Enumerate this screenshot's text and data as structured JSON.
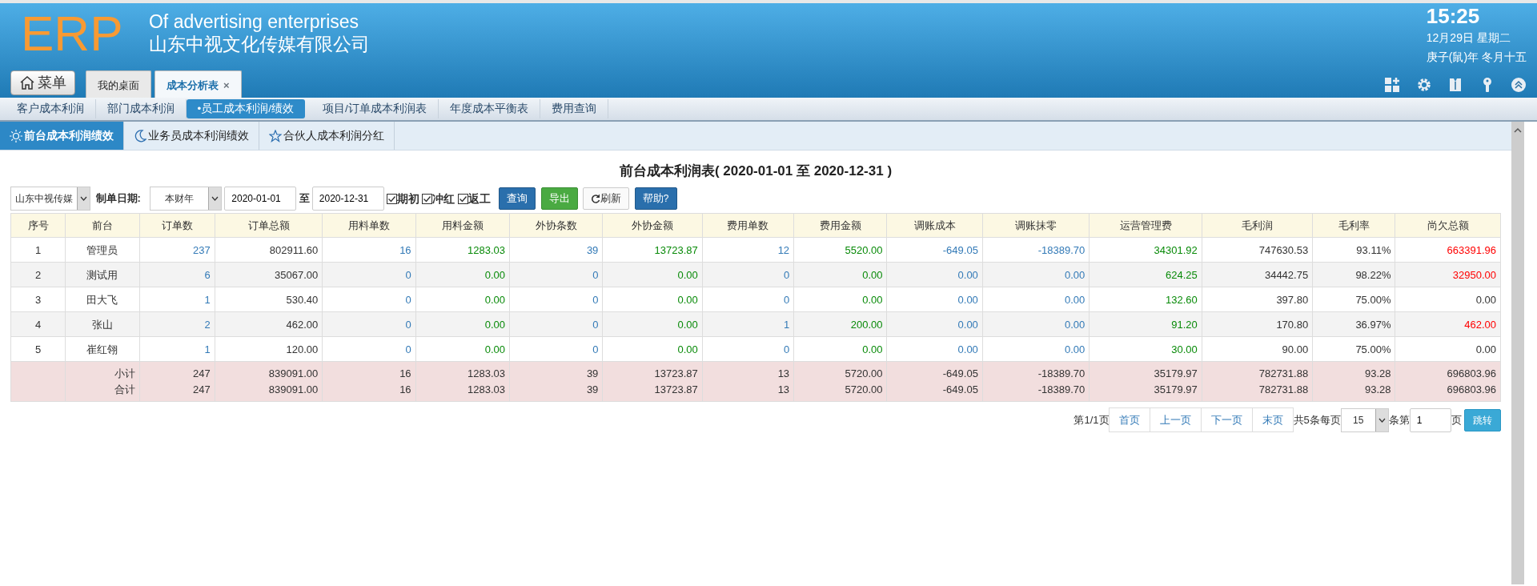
{
  "header": {
    "logo": "ERP",
    "subtitle": "Of advertising enterprises",
    "company": "山东中视文化传媒有限公司",
    "clock": {
      "time": "15:25",
      "date": "12月29日 星期二",
      "lunar": "庚子(鼠)年 冬月十五"
    },
    "menu_button": "菜单",
    "tabs": [
      {
        "label": "我的桌面",
        "selected": false,
        "closable": false
      },
      {
        "label": "成本分析表",
        "selected": true,
        "closable": true
      }
    ],
    "close_glyph": "×"
  },
  "subnav": [
    {
      "label": "客户成本利润",
      "selected": false
    },
    {
      "label": "部门成本利润",
      "selected": false
    },
    {
      "label": "•员工成本利润/绩效",
      "selected": true
    },
    {
      "label": "项目/订单成本利润表",
      "selected": false
    },
    {
      "label": "年度成本平衡表",
      "selected": false
    },
    {
      "label": "费用查询",
      "selected": false
    }
  ],
  "report_tabs": [
    {
      "label": "前台成本利润绩效",
      "selected": true
    },
    {
      "label": "业务员成本利润绩效",
      "selected": false
    },
    {
      "label": "合伙人成本利润分红",
      "selected": false
    }
  ],
  "report_title": "前台成本利润表( 2020-01-01 至 2020-12-31 )",
  "filters": {
    "company": "山东中视传媒",
    "date_label": "制单日期:",
    "period": "本财年",
    "date_from": "2020-01-01",
    "to_label": "至",
    "date_to": "2020-12-31",
    "checks": [
      {
        "label": "期初",
        "checked": true
      },
      {
        "label": "冲红",
        "checked": true
      },
      {
        "label": "返工",
        "checked": true
      }
    ],
    "buttons": [
      {
        "label": "查询",
        "kind": "primary"
      },
      {
        "label": "导出",
        "kind": "success"
      },
      {
        "label": "刷新",
        "kind": "refresh"
      },
      {
        "label": "帮助?",
        "kind": "primary"
      }
    ]
  },
  "table": {
    "columns": [
      {
        "label": "序号",
        "kind": "center"
      },
      {
        "label": "前台",
        "kind": "center"
      },
      {
        "label": "订单数",
        "kind": "count"
      },
      {
        "label": "订单总额",
        "kind": "plain"
      },
      {
        "label": "用料单数",
        "kind": "count"
      },
      {
        "label": "用料金额",
        "kind": "amount"
      },
      {
        "label": "外协条数",
        "kind": "count"
      },
      {
        "label": "外协金额",
        "kind": "amount"
      },
      {
        "label": "费用单数",
        "kind": "count"
      },
      {
        "label": "费用金额",
        "kind": "amount"
      },
      {
        "label": "调账成本",
        "kind": "count"
      },
      {
        "label": "调账抹零",
        "kind": "count"
      },
      {
        "label": "运营管理费",
        "kind": "amount"
      },
      {
        "label": "毛利润",
        "kind": "plain"
      },
      {
        "label": "毛利率",
        "kind": "plain"
      },
      {
        "label": "尚欠总额",
        "kind": "debt"
      }
    ],
    "rows": [
      {
        "cells": [
          "1",
          "管理员",
          "237",
          "802911.60",
          "16",
          "1283.03",
          "39",
          "13723.87",
          "12",
          "5520.00",
          "-649.05",
          "-18389.70",
          "34301.92",
          "747630.53",
          "93.11%",
          "663391.96"
        ],
        "overdue": true
      },
      {
        "cells": [
          "2",
          "测试用",
          "6",
          "35067.00",
          "0",
          "0.00",
          "0",
          "0.00",
          "0",
          "0.00",
          "0.00",
          "0.00",
          "624.25",
          "34442.75",
          "98.22%",
          "32950.00"
        ],
        "overdue": true
      },
      {
        "cells": [
          "3",
          "田大飞",
          "1",
          "530.40",
          "0",
          "0.00",
          "0",
          "0.00",
          "0",
          "0.00",
          "0.00",
          "0.00",
          "132.60",
          "397.80",
          "75.00%",
          "0.00"
        ],
        "overdue": false
      },
      {
        "cells": [
          "4",
          "张山",
          "2",
          "462.00",
          "0",
          "0.00",
          "0",
          "0.00",
          "1",
          "200.00",
          "0.00",
          "0.00",
          "91.20",
          "170.80",
          "36.97%",
          "462.00"
        ],
        "overdue": true
      },
      {
        "cells": [
          "5",
          "崔红翎",
          "1",
          "120.00",
          "0",
          "0.00",
          "0",
          "0.00",
          "0",
          "0.00",
          "0.00",
          "0.00",
          "30.00",
          "90.00",
          "75.00%",
          "0.00"
        ],
        "overdue": false
      }
    ],
    "totals": [
      {
        "label": "小计",
        "cells": [
          "247",
          "839091.00",
          "16",
          "1283.03",
          "39",
          "13723.87",
          "13",
          "5720.00",
          "-649.05",
          "-18389.70",
          "35179.97",
          "782731.88",
          "93.28",
          "696803.96"
        ]
      },
      {
        "label": "合计",
        "cells": [
          "247",
          "839091.00",
          "16",
          "1283.03",
          "39",
          "13723.87",
          "13",
          "5720.00",
          "-649.05",
          "-18389.70",
          "35179.97",
          "782731.88",
          "93.28",
          "696803.96"
        ]
      }
    ]
  },
  "pagination": {
    "page_info": "第1/1页",
    "links": [
      "首页",
      "上一页",
      "下一页",
      "末页"
    ],
    "total_info": "共5条每页",
    "page_size": "15",
    "page_label_before": "条第",
    "page_input": "1",
    "page_label_after": "页",
    "go_button": "跳转"
  }
}
